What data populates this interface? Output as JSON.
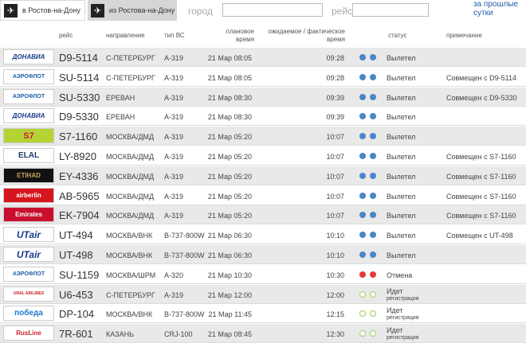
{
  "tabs": {
    "arrivals": "в Ростов-на-Дону",
    "departures": "из Ростова-на-Дону"
  },
  "search": {
    "city_label": "город",
    "flight_label": "рейс"
  },
  "past_link": "за прошлые сутки",
  "headers": {
    "flight": "рейс",
    "direction": "направление",
    "aircraft": "тип ВС",
    "scheduled": "плановое время",
    "actual": "ожидаемое / фактическое время",
    "status": "статус",
    "note": "примечание"
  },
  "colors": {
    "blue": "#4a86c8",
    "red": "#e03c3c",
    "green": "#9bd15a",
    "row_alt": "#e9e9e9"
  },
  "flights": [
    {
      "logo": "ДОНАВИА",
      "flight": "D9-5114",
      "dir": "С-ПЕТЕРБУРГ",
      "ac": "A-319",
      "plan": "21 Мар 08:05",
      "fact": "09:28",
      "dots": "blue",
      "status": "Вылетел",
      "sub": "",
      "note": ""
    },
    {
      "logo": "АЭРОФЛОТ",
      "flight": "SU-5114",
      "dir": "С-ПЕТЕРБУРГ",
      "ac": "A-319",
      "plan": "21 Мар 08:05",
      "fact": "09:28",
      "dots": "blue",
      "status": "Вылетел",
      "sub": "",
      "note": "Совмещен с D9-5114"
    },
    {
      "logo": "АЭРОФЛОТ",
      "flight": "SU-5330",
      "dir": "ЕРЕВАН",
      "ac": "A-319",
      "plan": "21 Мар 08:30",
      "fact": "09:39",
      "dots": "blue",
      "status": "Вылетел",
      "sub": "",
      "note": "Совмещен с D9-5330"
    },
    {
      "logo": "ДОНАВИА",
      "flight": "D9-5330",
      "dir": "ЕРЕВАН",
      "ac": "A-319",
      "plan": "21 Мар 08:30",
      "fact": "09:39",
      "dots": "blue",
      "status": "Вылетел",
      "sub": "",
      "note": ""
    },
    {
      "logo": "S7",
      "flight": "S7-1160",
      "dir": "МОСКВА/ДМД",
      "ac": "A-319",
      "plan": "21 Мар 05:20",
      "fact": "10:07",
      "dots": "blue",
      "status": "Вылетел",
      "sub": "",
      "note": ""
    },
    {
      "logo": "ELAL",
      "flight": "LY-8920",
      "dir": "МОСКВА/ДМД",
      "ac": "A-319",
      "plan": "21 Мар 05:20",
      "fact": "10:07",
      "dots": "blue",
      "status": "Вылетел",
      "sub": "",
      "note": "Совмещен с S7-1160"
    },
    {
      "logo": "ETIHAD",
      "flight": "EY-4336",
      "dir": "МОСКВА/ДМД",
      "ac": "A-319",
      "plan": "21 Мар 05:20",
      "fact": "10:07",
      "dots": "blue",
      "status": "Вылетел",
      "sub": "",
      "note": "Совмещен с S7-1160"
    },
    {
      "logo": "airberlin",
      "flight": "AB-5965",
      "dir": "МОСКВА/ДМД",
      "ac": "A-319",
      "plan": "21 Мар 05:20",
      "fact": "10:07",
      "dots": "blue",
      "status": "Вылетел",
      "sub": "",
      "note": "Совмещен с S7-1160"
    },
    {
      "logo": "Emirates",
      "flight": "EK-7904",
      "dir": "МОСКВА/ДМД",
      "ac": "A-319",
      "plan": "21 Мар 05:20",
      "fact": "10:07",
      "dots": "blue",
      "status": "Вылетел",
      "sub": "",
      "note": "Совмещен с S7-1160"
    },
    {
      "logo": "UTair",
      "flight": "UT-494",
      "dir": "МОСКВА/ВНК",
      "ac": "B-737-800W",
      "plan": "21 Мар 06:30",
      "fact": "10:10",
      "dots": "blue",
      "status": "Вылетел",
      "sub": "",
      "note": "Совмещен с UT-498"
    },
    {
      "logo": "UTair",
      "flight": "UT-498",
      "dir": "МОСКВА/ВНК",
      "ac": "B-737-800W",
      "plan": "21 Мар 06:30",
      "fact": "10:10",
      "dots": "blue",
      "status": "Вылетел",
      "sub": "",
      "note": ""
    },
    {
      "logo": "АЭРОФЛОТ",
      "flight": "SU-1159",
      "dir": "МОСКВА/ШРМ",
      "ac": "A-320",
      "plan": "21 Мар 10:30",
      "fact": "10:30",
      "dots": "red",
      "status": "Отмена",
      "sub": "",
      "note": ""
    },
    {
      "logo": "URAL AIRLINES",
      "flight": "U6-453",
      "dir": "С-ПЕТЕРБУРГ",
      "ac": "A-319",
      "plan": "21 Мар 12:00",
      "fact": "12:00",
      "dots": "green",
      "status": "Идет",
      "sub": "регистрация",
      "note": ""
    },
    {
      "logo": "победа",
      "flight": "DP-104",
      "dir": "МОСКВА/ВНК",
      "ac": "B-737-800W",
      "plan": "21 Мар 11:45",
      "fact": "12:15",
      "dots": "green",
      "status": "Идет",
      "sub": "регистрация",
      "note": ""
    },
    {
      "logo": "RusLine",
      "flight": "7R-601",
      "dir": "КАЗАНЬ",
      "ac": "CRJ-100",
      "plan": "21 Мар 08:45",
      "fact": "12:30",
      "dots": "green",
      "status": "Идет",
      "sub": "регистрация",
      "note": ""
    }
  ]
}
